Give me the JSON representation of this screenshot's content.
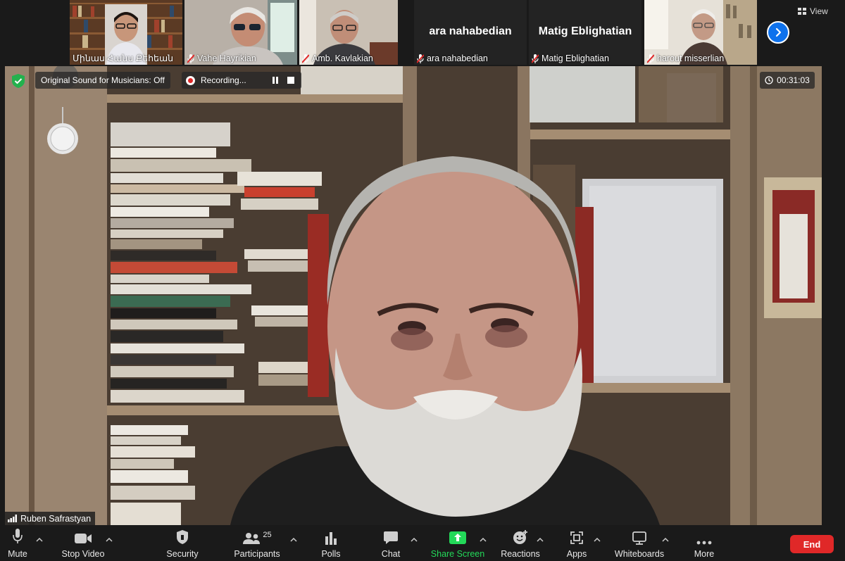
{
  "gallery": {
    "participants": [
      {
        "name": "Մինաս Հանս Քեհեան",
        "muted": false
      },
      {
        "name": "Vahe Hayrikian",
        "muted": true
      },
      {
        "name": "Amb. Kavlakian",
        "muted": true
      },
      {
        "name": "ara nahabedian",
        "muted": true,
        "display_name_big": "ara nahabedian"
      },
      {
        "name": "Matig Eblighatian",
        "muted": true,
        "display_name_big": "Matig Eblighatian"
      },
      {
        "name": "harout misserlian",
        "muted": true
      }
    ],
    "view_label": "View",
    "next_icon": "chevron-right-icon"
  },
  "meeting": {
    "original_sound": "Original Sound for Musicians: Off",
    "recording_label": "Recording...",
    "timer": "00:31:03",
    "active_speaker": "Ruben Safrastyan"
  },
  "toolbar": {
    "mute": "Mute",
    "stop_video": "Stop Video",
    "security": "Security",
    "participants": "Participants",
    "participants_count": "25",
    "polls": "Polls",
    "chat": "Chat",
    "share_screen": "Share Screen",
    "reactions": "Reactions",
    "apps": "Apps",
    "whiteboards": "Whiteboards",
    "more": "More",
    "end": "End"
  },
  "colors": {
    "accent_blue": "#0e72ed",
    "end_red": "#e02828",
    "share_green": "#23d959",
    "shield_green": "#23b14d"
  }
}
